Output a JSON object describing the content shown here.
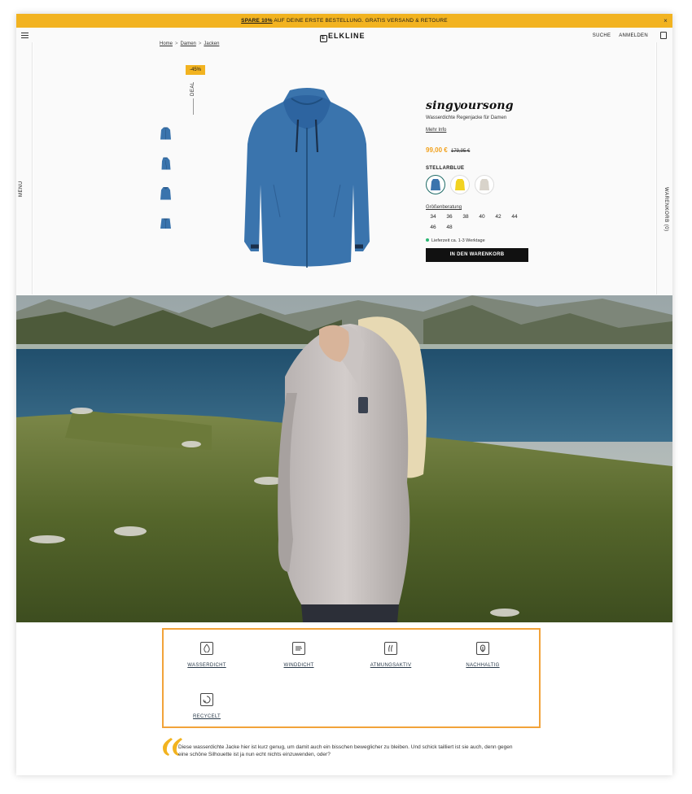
{
  "promo": {
    "highlight": "SPARE 10%",
    "text": " AUF DEINE ERSTE BESTELLUNG. GRATIS VERSAND & RETOURE",
    "close": "×"
  },
  "header": {
    "logo": "ELKLINE",
    "logo_mark": "E",
    "search": "SUCHE",
    "login": "ANMELDEN"
  },
  "sides": {
    "menu": "MENU",
    "cart": "WARENKORB (0)"
  },
  "breadcrumb": {
    "items": [
      "Home",
      "Damen",
      "Jacken"
    ],
    "separator": ">"
  },
  "product": {
    "discount_badge": "-45%",
    "deal_label": "DEAL",
    "name": "singyoursong",
    "description": "Wasserdichte Regenjacke für Damen",
    "more_info": "Mehr Info",
    "price_now": "99,00 €",
    "price_old": "179,95 €",
    "color_name": "STELLARBLUE",
    "swatch_colors": [
      "#3a74ad",
      "#f2d321",
      "#d8d3ca"
    ],
    "size_guide": "Größenberatung",
    "sizes": [
      "34",
      "36",
      "38",
      "40",
      "42",
      "44",
      "46",
      "48"
    ],
    "delivery": "Lieferzeit ca. 1-3 Werktage",
    "add_to_cart": "IN DEN WARENKORB",
    "jacket_color": "#3a74ad"
  },
  "features": [
    {
      "label": "WASSERDICHT",
      "icon": "water-drop-icon",
      "glyph": "💧"
    },
    {
      "label": "WINDDICHT",
      "icon": "wind-icon",
      "glyph": "≋"
    },
    {
      "label": "ATMUNGSAKTIV",
      "icon": "breathable-icon",
      "glyph": "⫽"
    },
    {
      "label": "NACHHALTIG",
      "icon": "leaf-icon",
      "glyph": "❦"
    },
    {
      "label": "RECYCELT",
      "icon": "recycle-icon",
      "glyph": "♻"
    }
  ],
  "quote": {
    "text": "Diese wasserdichte Jacke hier ist kurz genug, um damit auch ein bisschen beweglicher zu bleiben. Und schick tailliert ist sie auch, denn gegen eine schöne Silhouette ist ja nun echt nichts einzuwenden, oder?"
  },
  "colors": {
    "accent": "#f2b320",
    "highlight_border": "#f2a33a",
    "price": "#f2a11b",
    "button": "#111111"
  }
}
